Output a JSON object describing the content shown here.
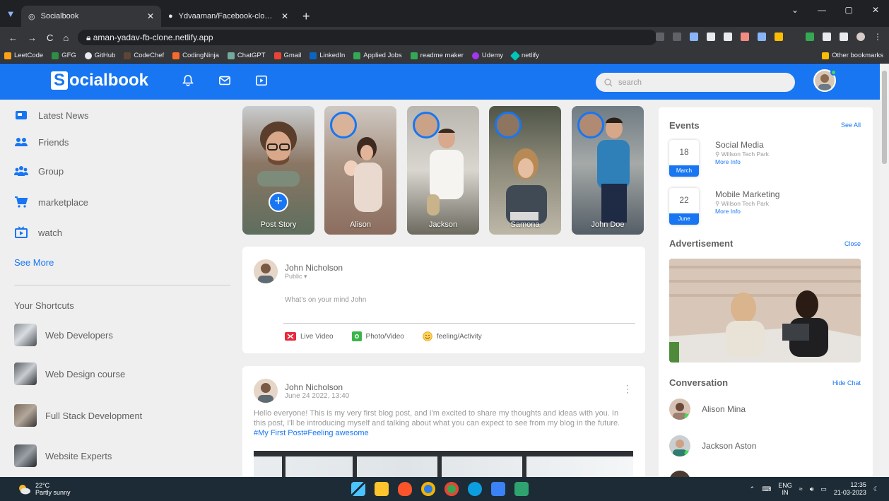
{
  "browser": {
    "tabs": [
      {
        "title": "Socialbook",
        "active": true
      },
      {
        "title": "Ydvaaman/Facebook-clone: You",
        "active": false
      }
    ],
    "new_tab": "+",
    "url": "aman-yadav-fb-clone.netlify.app",
    "bookmarks": [
      "LeetCode",
      "GFG",
      "GitHub",
      "CodeChef",
      "CodingNinja",
      "ChatGPT",
      "Gmail",
      "LinkedIn",
      "Applied Jobs",
      "readme maker",
      "Udemy",
      "netlify"
    ],
    "other_bookmarks": "Other bookmarks"
  },
  "navbar": {
    "logo_letter": "S",
    "logo_rest": "ocialbook",
    "search_placeholder": "search",
    "accent": "#1876f2"
  },
  "left_menu": {
    "items": [
      "Latest News",
      "Friends",
      "Group",
      "marketplace",
      "watch"
    ],
    "see_more": "See More",
    "shortcuts_title": "Your Shortcuts",
    "shortcuts": [
      "Web Developers",
      "Web Design course",
      "Full Stack Development",
      "Website Experts"
    ]
  },
  "stories": [
    {
      "name": "Post Story"
    },
    {
      "name": "Alison"
    },
    {
      "name": "Jackson"
    },
    {
      "name": "Samona"
    },
    {
      "name": "John Doe"
    }
  ],
  "composer": {
    "user": "John Nicholson",
    "privacy": "Public ▾",
    "placeholder": "What's on your mind John",
    "actions": [
      "Live Video",
      "Photo/Video",
      "feeling/Activity"
    ]
  },
  "post": {
    "user": "John Nicholson",
    "date": "June 24 2022, 13:40",
    "text": "Hello everyone! This is my very first blog post, and I'm excited to share my thoughts and ideas with you. In this post, I'll be introducing myself and talking about what you can expect to see from my blog in the future.",
    "hashtags": "#My First Post#Feeling awesome",
    "menu": "⋮"
  },
  "sidebar": {
    "events_title": "Events",
    "see_all": "See All",
    "events": [
      {
        "day": "18",
        "month": "March",
        "title": "Social Media",
        "location": "Willson Tech Park",
        "more": "More Info"
      },
      {
        "day": "22",
        "month": "June",
        "title": "Mobile Marketing",
        "location": "Willson Tech Park",
        "more": "More Info"
      }
    ],
    "ad_title": "Advertisement",
    "close": "Close",
    "conv_title": "Conversation",
    "hide_chat": "Hide Chat",
    "conversations": [
      "Alison Mina",
      "Jackson Aston"
    ]
  },
  "taskbar": {
    "temp": "22°C",
    "weather": "Partly sunny",
    "lang1": "ENG",
    "lang2": "IN",
    "time": "12:35",
    "date": "21-03-2023"
  }
}
